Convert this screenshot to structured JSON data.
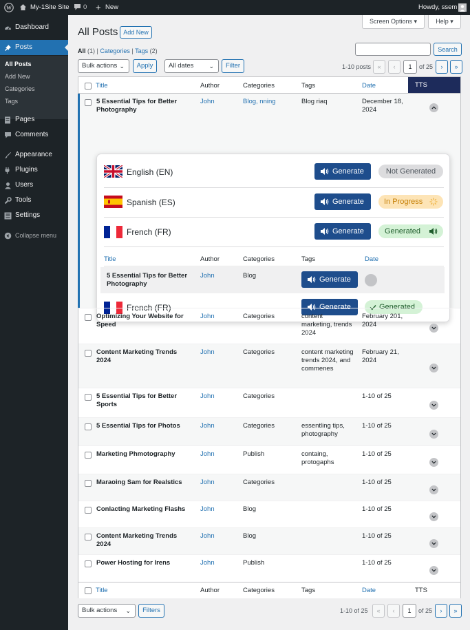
{
  "adminbar": {
    "site_name": "My-1Site Site",
    "comments_count": "0",
    "new_label": "New",
    "howdy": "Howdy, ssem"
  },
  "sidebar": {
    "dashboard": "Dashboard",
    "posts": "Posts",
    "posts_sub": [
      "All Posts",
      "Add New",
      "Categories",
      "Tags"
    ],
    "pages": "Pages",
    "comments": "Comments",
    "appearance": "Appearance",
    "plugins": "Plugins",
    "users": "Users",
    "tools": "Tools",
    "settings": "Settings",
    "collapse": "Collapse menu"
  },
  "header": {
    "title": "All Posts",
    "add_new": "Add New",
    "screen_options": "Screen Options ▾",
    "help": "Help ▾"
  },
  "filters": {
    "all": "All",
    "all_count": "(1)",
    "categories": "Categories",
    "tags": "Tags",
    "tags_count": "(2)",
    "search_button": "Search",
    "search_placeholder": "",
    "bulk_actions": "Bulk actions",
    "apply": "Apply",
    "all_dates": "All dates",
    "filter": "Filter",
    "items_count": "1-10 posts",
    "page_current": "1",
    "page_of": "of 25"
  },
  "columns": {
    "title": "Title",
    "author": "Author",
    "categories": "Categories",
    "tags": "Tags",
    "date": "Date",
    "tts": "TTS"
  },
  "first_post": {
    "title": "5 Essential Tips for Better Photography",
    "author": "John",
    "categories": "Blog, nning",
    "tags": "Blog riaq",
    "date": "December 18, 2024"
  },
  "panel": {
    "generate": "Generate",
    "langs": [
      {
        "name": "English (EN)",
        "status": "Not Generated"
      },
      {
        "name": "Spanish (ES)",
        "status": "In Progress"
      },
      {
        "name": "French (FR)",
        "status": "Generated"
      }
    ],
    "sub_columns": {
      "title": "Title",
      "author": "Author",
      "categories": "Categories",
      "tags": "Tags",
      "date": "Date"
    },
    "sub_row": {
      "title": "5 Essential Tips for Better Photography",
      "author": "John",
      "categories": "Blog"
    },
    "sub_lang": {
      "name": "French (FR)",
      "status": "Generated"
    }
  },
  "rows": [
    {
      "title": "Optimizing Your Website for Speed",
      "author": "John",
      "categories": "Categories",
      "tags": "content marketing, trends 2024",
      "date": "February 201, 2024"
    },
    {
      "title": "Content Marketing Trends 2024",
      "author": "John",
      "categories": "Categories",
      "tags": "content marketing trends 2024, and commenes",
      "date": "February 21, 2024"
    },
    {
      "title": "5 Essential Tips for Better Sports",
      "author": "John",
      "categories": "Categories",
      "tags": "",
      "date": "1-10 of 25"
    },
    {
      "title": "5 Essential Tips for Photos",
      "author": "John",
      "categories": "Categories",
      "tags": "essentling tips, photography",
      "date": "1-10 of 25"
    },
    {
      "title": "Marketing Phmotography",
      "author": "John",
      "categories": "Publish",
      "tags": "containg, protogaphs",
      "date": "1-10 of 25"
    },
    {
      "title": "Maraoing Sam for Realstics",
      "author": "John",
      "categories": "Categories",
      "tags": "",
      "date": "1-10 of 25"
    },
    {
      "title": "Conlacting Marketing Flashs",
      "author": "John",
      "categories": "Blog",
      "tags": "",
      "date": "1-10 of 25"
    },
    {
      "title": "Content Marketing Trends 2024",
      "author": "John",
      "categories": "Blog",
      "tags": "",
      "date": "1-10 of 25"
    },
    {
      "title": "Power Hosting for Irens",
      "author": "John",
      "categories": "Publish",
      "tags": "",
      "date": "1-10 of 25"
    }
  ],
  "footer": {
    "bulk_actions": "Bulk actions",
    "filters": "Filters",
    "items_count": "1-10 of 25",
    "page_current": "1",
    "page_of": "of 25"
  },
  "colors": {
    "admin_dark": "#1d2327",
    "accent": "#2271b1",
    "generate_blue": "#1e4d8c",
    "tts_header": "#1d2b5b",
    "generated_green": "#d4f2d6",
    "in_progress": "#fde4b6"
  }
}
